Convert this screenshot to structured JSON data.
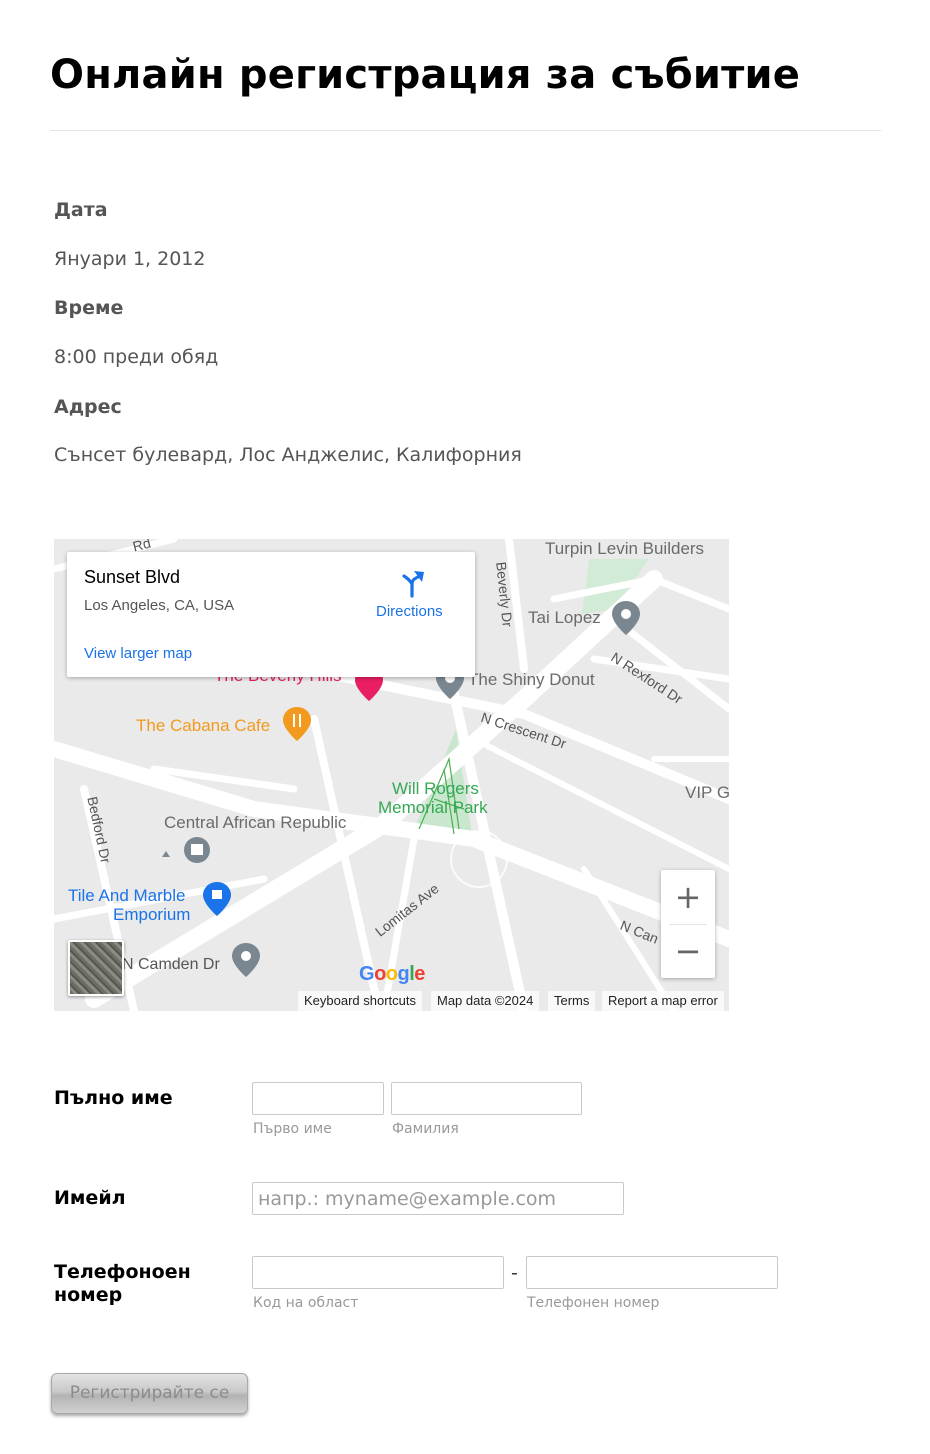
{
  "page": {
    "title": "Онлайн регистрация за събитие"
  },
  "event_info": {
    "date_label": "Дата",
    "date_value": "Януари 1, 2012",
    "time_label": "Време",
    "time_value": "8:00 преди обяд",
    "address_label": "Адрес",
    "address_value": "Сънсет булевард, Лос Анджелис, Калифорния"
  },
  "map": {
    "card_title": "Sunset Blvd",
    "card_subtitle": "Los Angeles, CA, USA",
    "view_larger_link": "View larger map",
    "directions_label": "Directions",
    "zoom_in": "+",
    "zoom_out": "−",
    "google_logo": "Google",
    "footer": {
      "keyboard_shortcuts": "Keyboard shortcuts",
      "map_data": "Map data ©2024",
      "terms": "Terms",
      "report_error": "Report a map error"
    },
    "places": {
      "turpin": "Turpin Levin Builders",
      "tai_lopez": "Tai Lopez",
      "beverly_hills": "The Beverly Hills",
      "shiny_donut": "The Shiny Donut",
      "cabana_cafe": "The Cabana Cafe",
      "will_rogers": "Will Rogers",
      "memorial_park": "Memorial Park",
      "car": "Central African Republic",
      "tile_marble_1": "Tile And Marble",
      "tile_marble_2": "Emporium",
      "vip": "VIP G"
    },
    "roads": {
      "beverly_dr": "Beverly Dr",
      "n_rexford": "N Rexford Dr",
      "n_crescent": "N Crescent Dr",
      "bedford": "Bedford Dr",
      "lomitas": "Lomitas Ave",
      "n_camden": "N Camden Dr",
      "n_can": "N Can",
      "rd": "Rd"
    },
    "colors": {
      "background": "#eaeaea",
      "road": "#ffffff",
      "park": "#c9e7cf",
      "poi_pink": "#e91e63",
      "poi_orange": "#f29a1d",
      "poi_blue": "#1a73e8",
      "poi_gray": "#7a8791",
      "park_text": "#34a853"
    }
  },
  "form": {
    "full_name_label": "Пълно име",
    "first_name_sublabel": "Първо име",
    "last_name_sublabel": "Фамилия",
    "first_name_value": "",
    "last_name_value": "",
    "email_label": "Имейл",
    "email_placeholder": "напр.: myname@example.com",
    "email_value": "",
    "phone_label_line1": "Телефоноен",
    "phone_label_line2": "номер",
    "area_code_sublabel": "Код на област",
    "phone_sublabel": "Телефонен номер",
    "area_code_value": "",
    "phone_value": "",
    "phone_separator": "-",
    "submit_label": "Регистрирайте се"
  }
}
